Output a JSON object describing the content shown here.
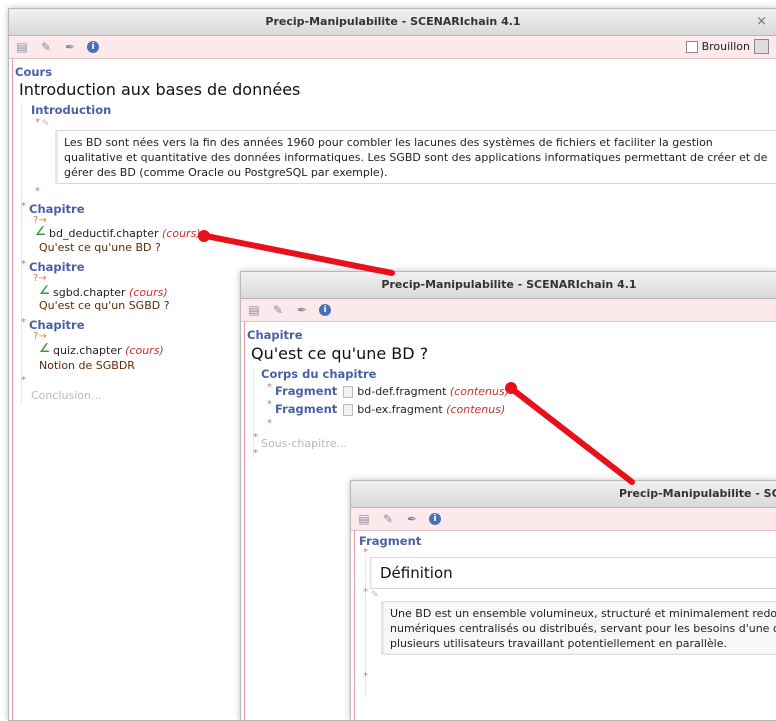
{
  "windows": {
    "main": {
      "title": "Precip-Manipulabilite - SCENARIchain 4.1",
      "close": "×"
    },
    "chapter": {
      "title": "Precip-Manipulabilite - SCENARIchain 4.1"
    },
    "fragment": {
      "title": "Precip-Manipulabilite - SCENARI"
    }
  },
  "toolbar": {
    "brouillon_label": "Brouillon"
  },
  "cours": {
    "label": "Cours",
    "title": "Introduction aux bases de données",
    "introduction_label": "Introduction",
    "intro_text": "Les BD sont nées vers la fin des années 1960 pour combler les lacunes des systèmes de fichiers et faciliter la gestion qualitative et quantitative des données informatiques. Les SGBD sont des applications informatiques permettant de créer et de gérer des BD (comme Oracle ou PostgreSQL par exemple).",
    "chapters": [
      {
        "label": "Chapitre",
        "file": "bd_deductif.chapter",
        "type": "(cours)",
        "subtitle": "Qu'est ce qu'une BD ?"
      },
      {
        "label": "Chapitre",
        "file": "sgbd.chapter",
        "type": "(cours)",
        "subtitle": "Qu'est ce qu'un SGBD ?"
      },
      {
        "label": "Chapitre",
        "file": "quiz.chapter",
        "type": "(cours)",
        "subtitle": "Notion de SGBDR"
      }
    ],
    "conclusion_placeholder": "Conclusion..."
  },
  "chapitre": {
    "label": "Chapitre",
    "title": "Qu'est ce qu'une BD ?",
    "corps_label": "Corps du chapitre",
    "fragments": [
      {
        "label": "Fragment",
        "file": "bd-def.fragment",
        "type": "(contenus)"
      },
      {
        "label": "Fragment",
        "file": "bd-ex.fragment",
        "type": "(contenus)"
      }
    ],
    "sous_chapitre_placeholder": "Sous-chapitre..."
  },
  "fragment": {
    "label": "Fragment",
    "title": "Définition",
    "text_lines": [
      "Une BD est un ensemble volumineux, structuré et minimalement redonda",
      "numériques centralisés ou distribués, servant pour les besoins d'une ou p",
      "plusieurs utilisateurs travaillant potentiellement en parallèle."
    ]
  },
  "colors": {
    "accent_label": "#4b5fa6",
    "link_type": "#c83232",
    "connector": "#e8101a",
    "toolbar_bg": "#fbe9ec"
  }
}
